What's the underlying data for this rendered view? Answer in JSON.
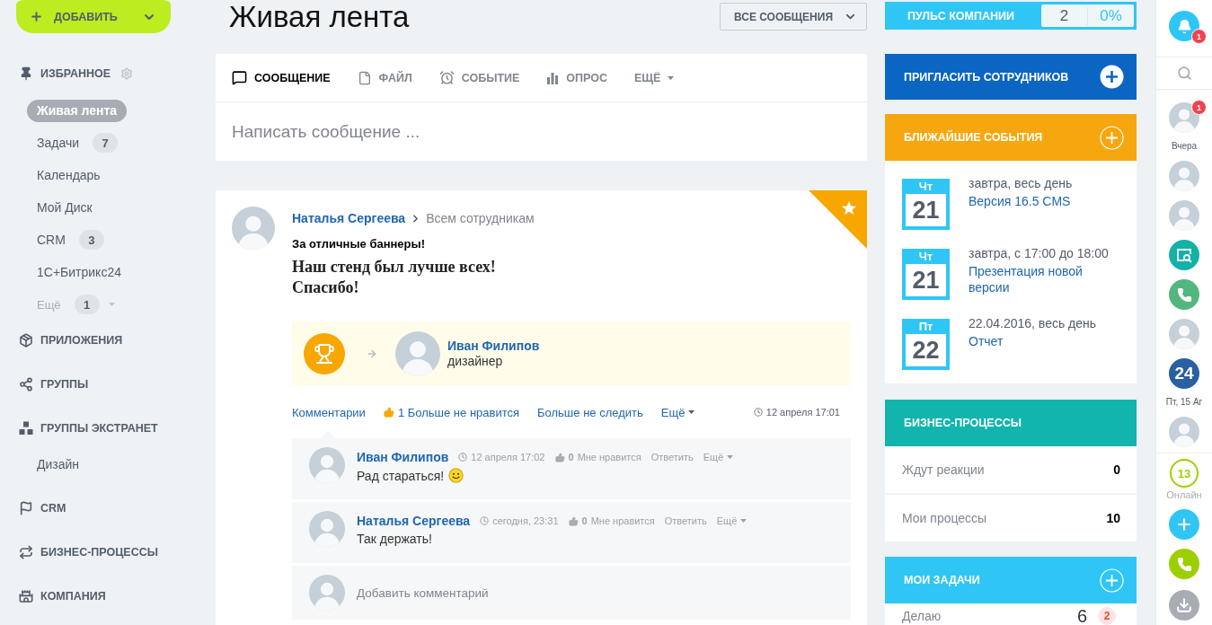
{
  "sidebar": {
    "add_button": {
      "label": "ДОБАВИТЬ"
    },
    "favorites": {
      "title": "ИЗБРАННОЕ",
      "items": [
        {
          "label": "Живая лента",
          "selected": true,
          "kind": "link"
        },
        {
          "label": "Задачи",
          "badge": "7",
          "selected": false,
          "kind": "link"
        },
        {
          "label": "Календарь",
          "selected": false,
          "kind": "link"
        },
        {
          "label": "Мой Диск",
          "selected": false,
          "kind": "link"
        },
        {
          "label": "CRM",
          "badge": "3",
          "selected": false,
          "kind": "link"
        },
        {
          "label": "1С+Битрикс24",
          "selected": false,
          "kind": "link"
        },
        {
          "label": "Ещё",
          "badge": "1",
          "selected": false,
          "kind": "more"
        }
      ]
    },
    "sections": [
      {
        "label": "ПРИЛОЖЕНИЯ"
      },
      {
        "label": "ГРУППЫ"
      },
      {
        "label": "ГРУППЫ ЭКСТРАНЕТ",
        "children": [
          {
            "label": "Дизайн"
          }
        ]
      },
      {
        "label": "CRM"
      },
      {
        "label": "БИЗНЕС-ПРОЦЕССЫ"
      },
      {
        "label": "КОМПАНИЯ"
      }
    ]
  },
  "feed": {
    "title": "Живая лента",
    "filter": "ВСЕ СООБЩЕНИЯ",
    "composer": {
      "tabs": [
        {
          "label": "СООБЩЕНИЕ",
          "selected": true,
          "kind": "message"
        },
        {
          "label": "ФАЙЛ",
          "selected": false,
          "kind": "file"
        },
        {
          "label": "СОБЫТИЕ",
          "selected": false,
          "kind": "event"
        },
        {
          "label": "ОПРОС",
          "selected": false,
          "kind": "poll"
        },
        {
          "label": "ЕЩЁ",
          "selected": false,
          "kind": "more"
        }
      ],
      "placeholder": "Написать сообщение ..."
    },
    "post": {
      "author": "Наталья Сергеева",
      "audience": "Всем сотрудникам",
      "favorite": true,
      "title": "За отличные баннеры!",
      "body": [
        "Наш стенд был лучше всех!",
        "Спасибо!"
      ],
      "gratitude": {
        "recipient": "Иван Филипов",
        "position": "дизайнер"
      },
      "actions": {
        "comments": "Комментарии",
        "like": {
          "count": "1",
          "label": "Больше не нравится",
          "liked": true
        },
        "follow": "Больше не следить",
        "more": "Ещё",
        "time": "12 апреля 17:01"
      },
      "comments": [
        {
          "author": "Иван Филипов",
          "time": "12 апреля 17:02",
          "like_count": "0",
          "like_label": "Мне нравится",
          "liked": false,
          "reply": "Ответить",
          "more": "Ещё",
          "text": "Рад стараться!",
          "emoji": true
        },
        {
          "author": "Наталья Сергеева",
          "time": "сегодня, 23:31",
          "like_count": "0",
          "like_label": "Мне нравится",
          "liked": false,
          "reply": "Ответить",
          "more": "Ещё",
          "text": "Так держать!",
          "emoji": false
        }
      ],
      "add_comment": {
        "placeholder": "Добавить комментарий"
      }
    }
  },
  "widgets": {
    "pulse": {
      "title": "ПУЛЬС КОМПАНИИ",
      "count": "2",
      "percent": "0%"
    },
    "invite": {
      "title": "ПРИГЛАСИТЬ СОТРУДНИКОВ"
    },
    "events": {
      "title": "БЛИЖАЙШИЕ СОБЫТИЯ",
      "items": [
        {
          "weekday": "Чт",
          "day": "21",
          "when": "завтра, весь день",
          "name": "Версия 16.5 CMS"
        },
        {
          "weekday": "Чт",
          "day": "21",
          "when": "завтра, с 17:00 до 18:00",
          "name": "Презентация новой версии"
        },
        {
          "weekday": "Пт",
          "day": "22",
          "when": "22.04.2016, весь день",
          "name": "Отчет"
        }
      ]
    },
    "processes": {
      "title": "БИЗНЕС-ПРОЦЕССЫ",
      "rows": [
        {
          "label": "Ждут реакции",
          "value": "0"
        },
        {
          "label": "Мои процессы",
          "value": "10"
        }
      ]
    },
    "tasks": {
      "title": "МОИ ЗАДАЧИ",
      "rows": [
        {
          "label": "Делаю",
          "value": "6",
          "badge": "2"
        }
      ]
    }
  },
  "right_bar": {
    "notifications": {
      "badge": "1"
    },
    "items": [
      {
        "kind": "avatar",
        "badge": "1"
      },
      {
        "kind": "date",
        "label": "Вчера"
      },
      {
        "kind": "avatar"
      },
      {
        "kind": "avatar"
      },
      {
        "kind": "screen"
      },
      {
        "kind": "call"
      },
      {
        "kind": "avatar"
      },
      {
        "kind": "logo",
        "text": "24"
      },
      {
        "kind": "date",
        "label": "Пт, 15 Аг"
      },
      {
        "kind": "avatar"
      }
    ],
    "online": {
      "count": "13",
      "label": "Онлайн"
    }
  }
}
